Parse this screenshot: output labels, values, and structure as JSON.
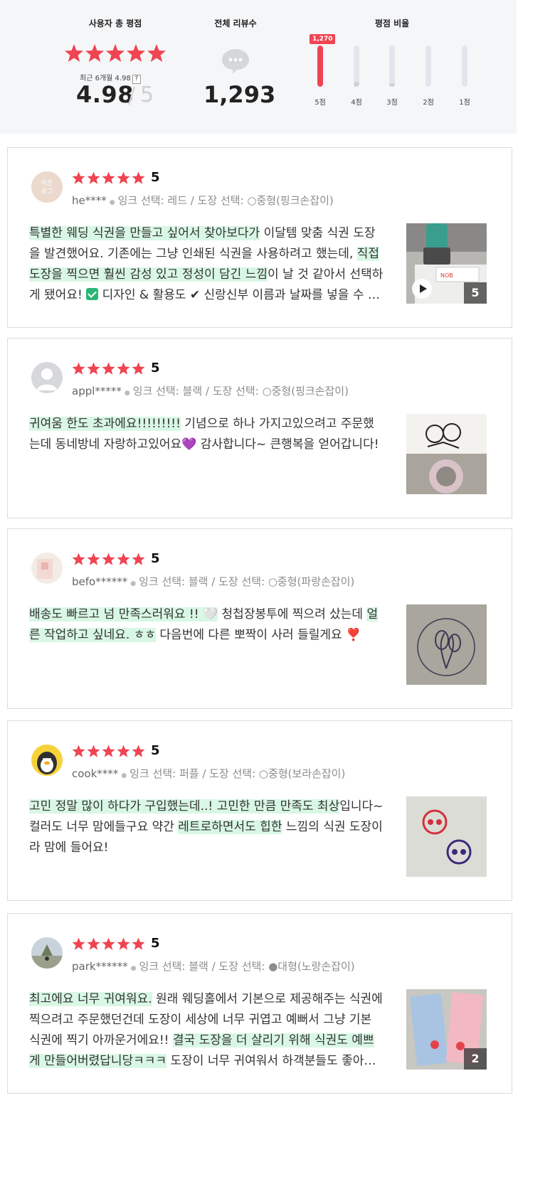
{
  "summary": {
    "avg_heading": "사용자 총 평점",
    "count_heading": "전체 리뷰수",
    "ratio_heading": "평점 비율",
    "recent_text": "최근 6개월 4.98",
    "recent_help": "?",
    "average": "4.98",
    "slash": "/",
    "max_score": "5",
    "total_reviews": "1,293",
    "colors": {
      "accent": "#f04452",
      "bar_track": "#e4e5ec",
      "highlight": "#d9f7e5"
    },
    "distribution": [
      {
        "label": "5점",
        "count": 1270,
        "badge": "1,270",
        "fraction": 1.0
      },
      {
        "label": "4점",
        "count": null,
        "fraction": 0.12
      },
      {
        "label": "3점",
        "count": null,
        "fraction": 0.08
      },
      {
        "label": "2점",
        "count": null,
        "fraction": 0.0
      },
      {
        "label": "1점",
        "count": null,
        "fraction": 0.0
      }
    ]
  },
  "reviews": [
    {
      "score": "5",
      "user": "he****",
      "options": "잉크 선택: 레드 / 도장 선택: ○중형(핑크손잡이)",
      "text_parts": [
        {
          "t": "특별한 웨딩 식권을 만들고 싶어서 찾아보다가",
          "hl": true
        },
        {
          "t": " 이달템 맞춤 식권 도장을 발견했어요. 기존에는 그냥 인쇄된 식권을 사용하려고 했는데, ",
          "hl": false
        },
        {
          "t": "직접 도장을 찍으면 훨씬 감성 있고 정성이 담긴 느낌",
          "hl": true
        },
        {
          "t": "이 날 것 같아서 선택하게 됐어요! ",
          "hl": false
        },
        {
          "t": "",
          "hl": false,
          "icon": "check-emoji"
        },
        {
          "t": " 디자인 & 활용도 ✔ 신랑신부 이름과 날짜를 넣을 수 있어서",
          "hl": false
        }
      ],
      "photo_count": "5",
      "has_video": true,
      "avatar_text": "하은\n로그"
    },
    {
      "score": "5",
      "user": "appl*****",
      "options": "잉크 선택: 블랙 / 도장 선택: ○중형(핑크손잡이)",
      "text_parts": [
        {
          "t": "귀여움 한도 초과에요!!!!!!!!!",
          "hl": true
        },
        {
          "t": " 기념으로 하나 가지고있으려고 주문했는데 동네방네 자랑하고있어요💜 감사합니다~ 큰행복을 얻어갑니다!",
          "hl": false
        }
      ],
      "photo_count": "",
      "has_video": false
    },
    {
      "score": "5",
      "user": "befo******",
      "options": "잉크 선택: 블랙 / 도장 선택: ○중형(파랑손잡이)",
      "text_parts": [
        {
          "t": "배송도 빠르고 넘 만족스러워요 !! 🤍",
          "hl": true
        },
        {
          "t": " 청첩장봉투에 찍으려 샀는데 ",
          "hl": false
        },
        {
          "t": "얼른 작업하고 싶네요. ㅎㅎ",
          "hl": true
        },
        {
          "t": " 다음번에 다른 뽀짝이 사러 들릴게요 ❣️",
          "hl": false
        }
      ],
      "photo_count": "",
      "has_video": false
    },
    {
      "score": "5",
      "user": "cook****",
      "options": "잉크 선택: 퍼플 / 도장 선택: ○중형(보라손잡이)",
      "text_parts": [
        {
          "t": "고민 정말 많이 하다가 구입했는데..! 고민한 만큼 만족도 최상",
          "hl": true
        },
        {
          "t": "입니다~ 컬러도 너무 맘에들구요 약간 ",
          "hl": false
        },
        {
          "t": "레트로하면서도 힙한",
          "hl": true
        },
        {
          "t": " 느낌의 식권 도장이라 맘에 들어요!",
          "hl": false
        }
      ],
      "photo_count": "",
      "has_video": false
    },
    {
      "score": "5",
      "user": "park******",
      "options": "잉크 선택: 블랙 / 도장 선택: ●대형(노랑손잡이)",
      "text_parts": [
        {
          "t": "최고에요 너무 귀여워요.",
          "hl": true
        },
        {
          "t": " 원래 웨딩홀에서 기본으로 제공해주는 식권에 찍으려고 주문했던건데 도장이 세상에 너무 귀엽고 예뻐서 그냥 기본 식권에 찍기 아까운거에요!! ",
          "hl": false
        },
        {
          "t": "결국 도장을 더 살리기 위해 식권도 예쁘게 만들어버렸답니당ㅋㅋㅋ",
          "hl": true
        },
        {
          "t": " 도장이 너무 귀여워서 하객분들도 좋아하셨어요",
          "hl": false
        }
      ],
      "photo_count": "2",
      "has_video": false
    }
  ]
}
